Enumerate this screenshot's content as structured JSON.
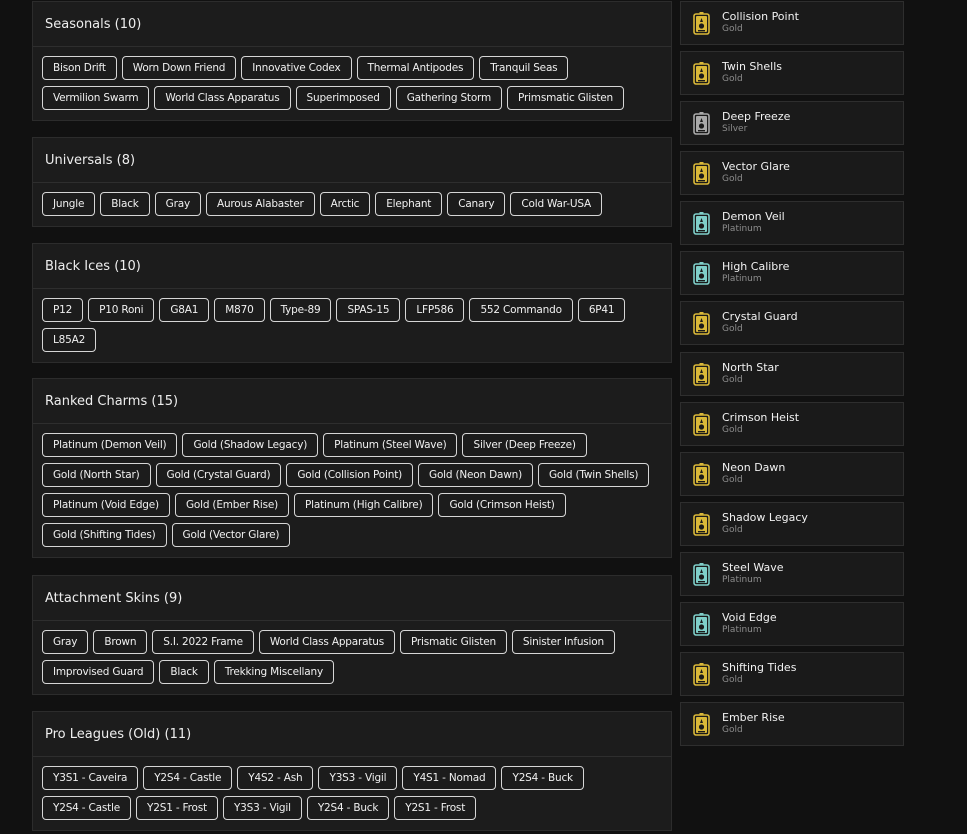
{
  "colors": {
    "gold": "#d9b838",
    "silver": "#a9a9a9",
    "platinum": "#7fcfc9"
  },
  "sections": [
    {
      "title": "Seasonals (10)",
      "tags": [
        "Bison Drift",
        "Worn Down Friend",
        "Innovative Codex",
        "Thermal Antipodes",
        "Tranquil Seas",
        "Vermilion Swarm",
        "World Class Apparatus",
        "Superimposed",
        "Gathering Storm",
        "Primsmatic Glisten"
      ]
    },
    {
      "title": "Universals (8)",
      "tags": [
        "Jungle",
        "Black",
        "Gray",
        "Aurous Alabaster",
        "Arctic",
        "Elephant",
        "Canary",
        "Cold War-USA"
      ]
    },
    {
      "title": "Black Ices (10)",
      "tags": [
        "P12",
        "P10 Roni",
        "G8A1",
        "M870",
        "Type-89",
        "SPAS-15",
        "LFP586",
        "552 Commando",
        "6P41",
        "L85A2"
      ]
    },
    {
      "title": "Ranked Charms (15)",
      "tags": [
        "Platinum (Demon Veil)",
        "Gold (Shadow Legacy)",
        "Platinum (Steel Wave)",
        "Silver (Deep Freeze)",
        "Gold (North Star)",
        "Gold (Crystal Guard)",
        "Gold (Collision Point)",
        "Gold (Neon Dawn)",
        "Gold (Twin Shells)",
        "Platinum (Void Edge)",
        "Gold (Ember Rise)",
        "Platinum (High Calibre)",
        "Gold (Crimson Heist)",
        "Gold (Shifting Tides)",
        "Gold (Vector Glare)"
      ]
    },
    {
      "title": "Attachment Skins (9)",
      "tags": [
        "Gray",
        "Brown",
        "S.I. 2022 Frame",
        "World Class Apparatus",
        "Prismatic Glisten",
        "Sinister Infusion",
        "Improvised Guard",
        "Black",
        "Trekking Miscellany"
      ]
    },
    {
      "title": "Pro Leagues (Old) (11)",
      "tags": [
        "Y3S1 - Caveira",
        "Y2S4 - Castle",
        "Y4S2 - Ash",
        "Y3S3 - Vigil",
        "Y4S1 - Nomad",
        "Y2S4 - Buck",
        "Y2S4 - Castle",
        "Y2S1 - Frost",
        "Y3S3 - Vigil",
        "Y2S4 - Buck",
        "Y2S1 - Frost"
      ]
    }
  ],
  "charms": [
    {
      "name": "Collision Point",
      "tier": "Gold",
      "icon": "rank-charm-icon"
    },
    {
      "name": "Twin Shells",
      "tier": "Gold",
      "icon": "rank-charm-icon"
    },
    {
      "name": "Deep Freeze",
      "tier": "Silver",
      "icon": "rank-charm-icon"
    },
    {
      "name": "Vector Glare",
      "tier": "Gold",
      "icon": "rank-charm-icon"
    },
    {
      "name": "Demon Veil",
      "tier": "Platinum",
      "icon": "rank-charm-icon"
    },
    {
      "name": "High Calibre",
      "tier": "Platinum",
      "icon": "rank-charm-icon"
    },
    {
      "name": "Crystal Guard",
      "tier": "Gold",
      "icon": "rank-charm-icon"
    },
    {
      "name": "North Star",
      "tier": "Gold",
      "icon": "rank-charm-icon"
    },
    {
      "name": "Crimson Heist",
      "tier": "Gold",
      "icon": "rank-charm-icon"
    },
    {
      "name": "Neon Dawn",
      "tier": "Gold",
      "icon": "rank-charm-icon"
    },
    {
      "name": "Shadow Legacy",
      "tier": "Gold",
      "icon": "rank-charm-icon"
    },
    {
      "name": "Steel Wave",
      "tier": "Platinum",
      "icon": "rank-charm-icon"
    },
    {
      "name": "Void Edge",
      "tier": "Platinum",
      "icon": "rank-charm-icon"
    },
    {
      "name": "Shifting Tides",
      "tier": "Gold",
      "icon": "rank-charm-icon"
    },
    {
      "name": "Ember Rise",
      "tier": "Gold",
      "icon": "rank-charm-icon"
    }
  ]
}
